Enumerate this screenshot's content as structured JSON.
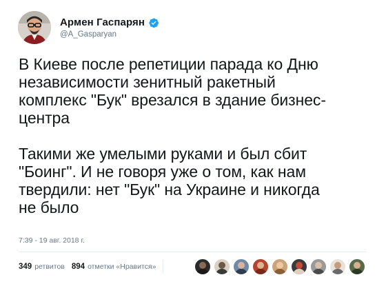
{
  "author": {
    "display_name": "Армен Гаспарян",
    "handle": "@A_Gasparyan",
    "verified": true,
    "avatar_icon": "user-avatar-icon",
    "verified_color": "#1da1f2"
  },
  "tweet": {
    "text": "В Киеве после репетиции парада ко Дню\nнезависимости зенитный ракетный\nкомплекс \"Бук\" врезался в здание бизнес-\nцентра\n\nТакими же умелыми руками и был сбит\n\"Боинг\". И не говоря уже о том, как нам\nтвердили: нет \"Бук\" на Украине и никогда\nне было",
    "timestamp": "7:39 - 19 авг. 2018 г."
  },
  "stats": {
    "retweets_count": "349",
    "retweets_label": "ретвитов",
    "likes_count": "894",
    "likes_label": "отметки «Нравится»"
  },
  "likers": [
    {
      "icon": "liker-avatar-icon",
      "bg": "#2b2b2b",
      "head": "#8a6a55",
      "torso": "#1a1a1a"
    },
    {
      "icon": "liker-avatar-icon",
      "bg": "#d9d2c4",
      "head": "#6b5a4a",
      "torso": "#3a3a3a"
    },
    {
      "icon": "liker-avatar-icon",
      "bg": "#6f8aa8",
      "head": "#d8b59a",
      "torso": "#2e3d52"
    },
    {
      "icon": "liker-avatar-icon",
      "bg": "#b4452f",
      "head": "#e0b390",
      "torso": "#7a2818"
    },
    {
      "icon": "liker-avatar-icon",
      "bg": "#c9a57a",
      "head": "#f0c8a0",
      "torso": "#8b5e34"
    },
    {
      "icon": "liker-avatar-icon",
      "bg": "#3b3b3b",
      "head": "#c44a3a",
      "torso": "#e0d0c0"
    },
    {
      "icon": "liker-avatar-icon",
      "bg": "#9a9a9a",
      "head": "#d8c0a8",
      "torso": "#4a4a4a"
    },
    {
      "icon": "liker-avatar-icon",
      "bg": "#e8e3da",
      "head": "#c79b7a",
      "torso": "#6a6a6a"
    },
    {
      "icon": "liker-avatar-icon",
      "bg": "#556b4a",
      "head": "#d6b08c",
      "torso": "#2b3a24"
    }
  ]
}
